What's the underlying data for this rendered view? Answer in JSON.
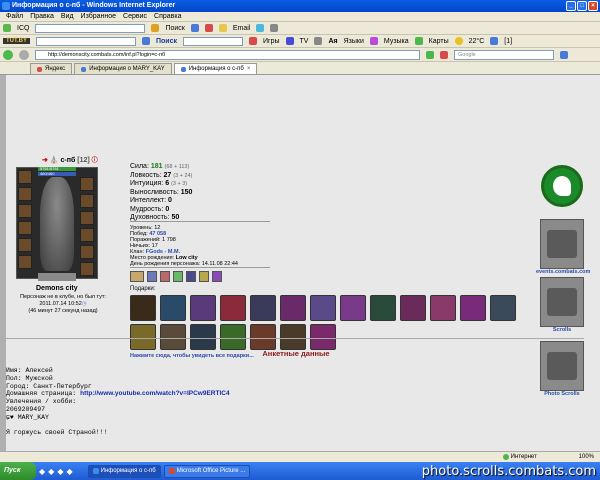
{
  "window": {
    "title": "Информация о с-пб - Windows Internet Explorer"
  },
  "menu": [
    "Файл",
    "Правка",
    "Вид",
    "Избранное",
    "Сервис",
    "Справка"
  ],
  "toolbar1": {
    "icq": "ICQ",
    "search": "Поиск",
    "email": "Email"
  },
  "toolbar2": {
    "search": "Поиск",
    "games": "Игры",
    "tv": "TV",
    "languages": "Языки",
    "music": "Музыка",
    "maps": "Карты",
    "weather": "22°C",
    "counter": "[1]"
  },
  "toolbar3": {
    "url": "http://demonscity.combats.com/inf.pl?login=c-пб",
    "search_placeholder": "Google"
  },
  "tabs": [
    {
      "label": "Яндекс"
    },
    {
      "label": "Информация о MARY_KAY"
    },
    {
      "label": "Информация о с-пб"
    }
  ],
  "character": {
    "name": "с-пб",
    "level": "[12]",
    "hp": "5761/5761",
    "mp": "460/460",
    "city": "Demons city",
    "status": "Персонаж не в клубе, но был тут:",
    "last_seen": "2011.07.14 10:52",
    "ago": "(46 минут 27 секунд назад)"
  },
  "stats": [
    {
      "label": "Сила:",
      "value": "181",
      "extra": "(68 + 113)",
      "green": true
    },
    {
      "label": "Ловкость:",
      "value": "27",
      "extra": "(3 + 24)"
    },
    {
      "label": "Интуиция:",
      "value": "6",
      "extra": "(3 + 3)"
    },
    {
      "label": "Выносливость:",
      "value": "150",
      "extra": ""
    },
    {
      "label": "Интеллект:",
      "value": "0",
      "extra": ""
    },
    {
      "label": "Мудрость:",
      "value": "0",
      "extra": ""
    },
    {
      "label": "Духовность:",
      "value": "50",
      "extra": ""
    }
  ],
  "info": {
    "level": "Уровень: 12",
    "wins_label": "Побед:",
    "wins": "47 058",
    "losses": "Поражений: 1 798",
    "draws": "Ничьих: 17",
    "clan_label": "Клан:",
    "clan": "FGods - M.M.",
    "birthplace_label": "Место рождения:",
    "birthplace": "Low city",
    "birthday": "День рождения персонажа: 14.11.08 22:44"
  },
  "gifts": {
    "title": "Подарки:",
    "link": "Нажмите сюда, чтобы увидеть все подарки..."
  },
  "sidebar": {
    "events": "events.combats.com",
    "scrolls": "Scrolls",
    "photo_scrolls": "Photo Scrolls"
  },
  "profile": {
    "title": "Анкетные данные",
    "name": "Имя: Алексей",
    "sex": "Пол: Мужской",
    "city": "Город: Санкт-Петербург",
    "homepage_label": "Домашняя страница:",
    "homepage": "http://www.youtube.com/watch?v=IPCw9ERTIC4",
    "hobby_label": "Увлечения / хобби:",
    "hobby": "2069209497",
    "mary": "MARY_KAY",
    "quote": "Я горжусь своей Страной!!!"
  },
  "status_bar": {
    "zone": "Интернет",
    "zoom": "100%"
  },
  "taskbar": {
    "start": "Пуск",
    "task1": "Информация о с-пб",
    "task2": "Microsoft Office Picture ...",
    "watermark": "photo.scrolls.combats.com"
  },
  "colors": {
    "title_bar": "#0a5de2",
    "section_title": "#8a1a1a",
    "link": "#2a4aa8"
  }
}
